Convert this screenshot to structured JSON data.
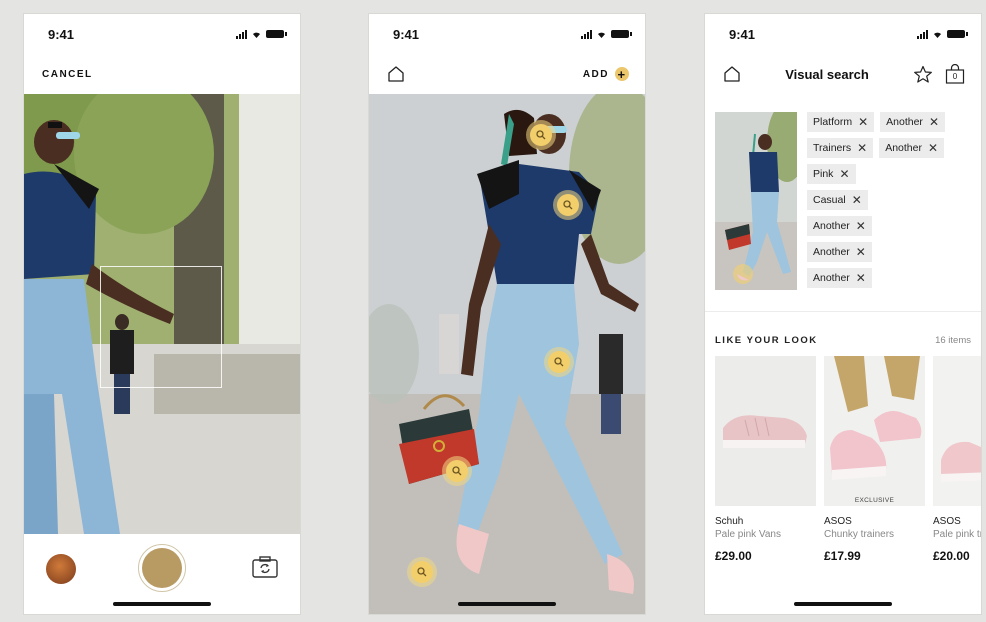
{
  "status_time": "9:41",
  "screen1": {
    "cancel_label": "CANCEL"
  },
  "screen2": {
    "add_label": "ADD",
    "add_symbol": "+"
  },
  "screen3": {
    "title": "Visual search",
    "bag_count": "0",
    "tags": [
      [
        "Platform",
        "Another"
      ],
      [
        "Trainers",
        "Another"
      ],
      [
        "Pink"
      ],
      [
        "Casual"
      ],
      [
        "Another"
      ],
      [
        "Another"
      ],
      [
        "Another"
      ]
    ],
    "section_title": "LIKE YOUR LOOK",
    "section_count": "16 items",
    "products": [
      {
        "brand": "Schuh",
        "name": "Pale pink Vans",
        "price": "£29.00",
        "badge": ""
      },
      {
        "brand": "ASOS",
        "name": "Chunky trainers",
        "price": "£17.99",
        "badge": "EXCLUSIVE"
      },
      {
        "brand": "ASOS",
        "name": "Pale pink trainers",
        "price": "£20.00",
        "badge": ""
      }
    ]
  },
  "colors": {
    "accent": "#f3cf6c",
    "shutter": "#b89a63",
    "tag_bg": "#ececec"
  }
}
